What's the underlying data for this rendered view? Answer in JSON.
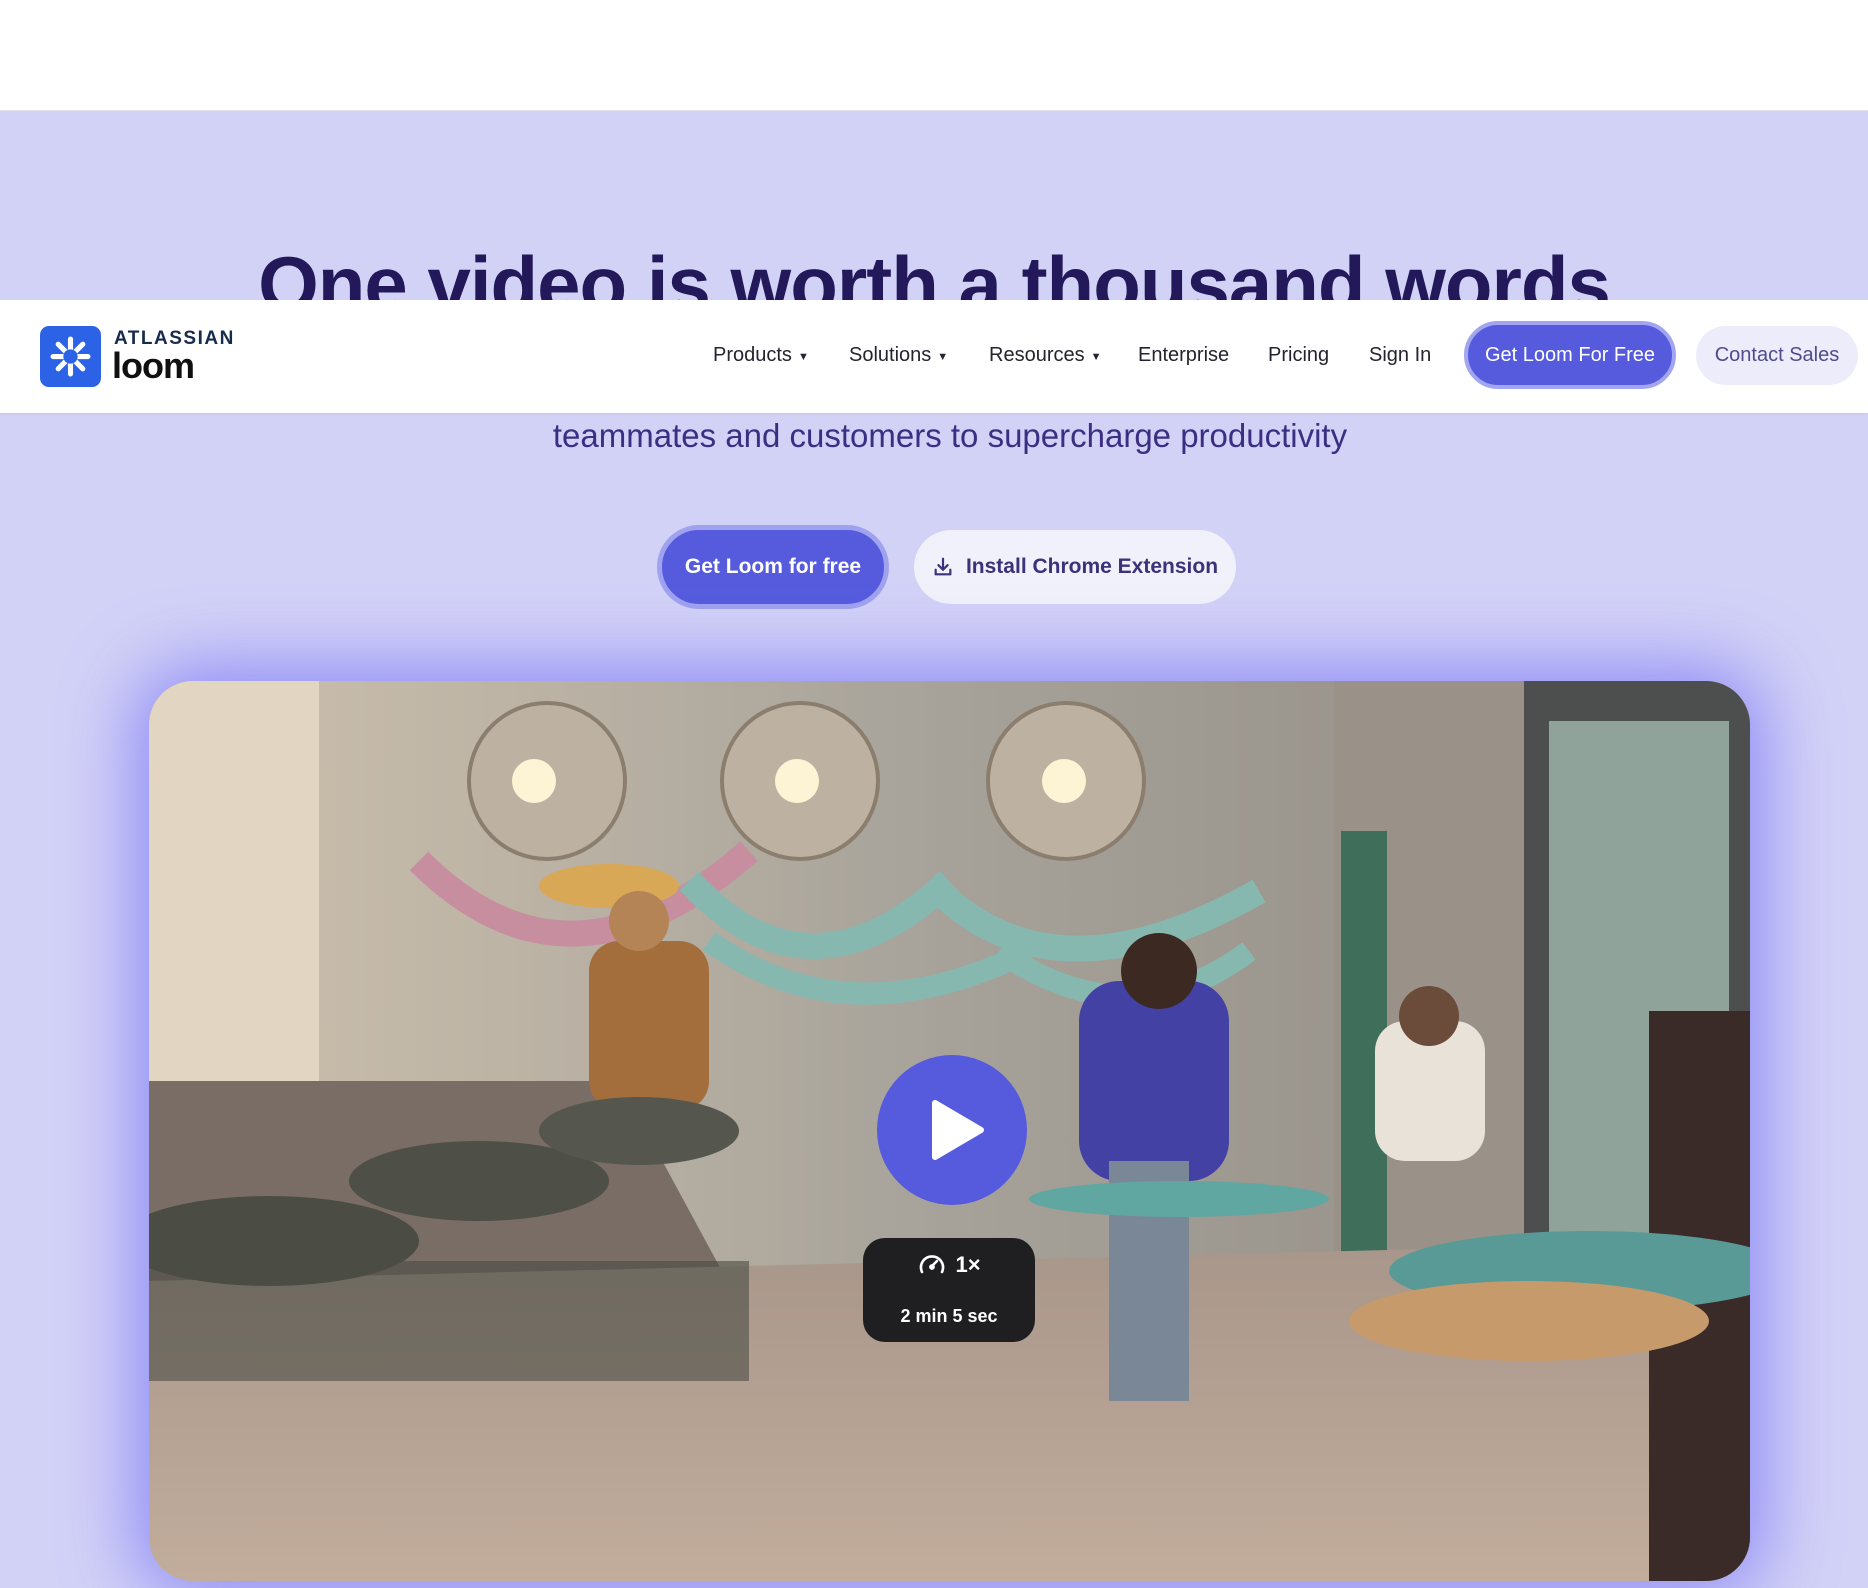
{
  "hero": {
    "title": "One video is worth a thousand words",
    "subtitle": "teammates and customers to supercharge productivity",
    "primary_cta": "Get Loom for free",
    "secondary_cta": "Install Chrome Extension"
  },
  "nav": {
    "brand_top": "ATLASSIAN",
    "brand_name": "loom",
    "items": [
      {
        "label": "Products",
        "dropdown": true
      },
      {
        "label": "Solutions",
        "dropdown": true
      },
      {
        "label": "Resources",
        "dropdown": true
      },
      {
        "label": "Enterprise",
        "dropdown": false
      },
      {
        "label": "Pricing",
        "dropdown": false
      },
      {
        "label": "Sign In",
        "dropdown": false
      }
    ],
    "cta": "Get Loom For Free",
    "contact": "Contact Sales",
    "caret": "▼"
  },
  "video": {
    "speed": "1×",
    "duration": "2 min 5 sec"
  },
  "colors": {
    "page_bg": "#d2d1f6",
    "accent": "#565add",
    "brand_blue": "#2c63e6",
    "title_text": "#22185a"
  },
  "icons": {
    "logo": "loom-asterisk-icon",
    "download": "download-icon",
    "play": "play-icon",
    "speed": "speed-gauge-icon"
  }
}
